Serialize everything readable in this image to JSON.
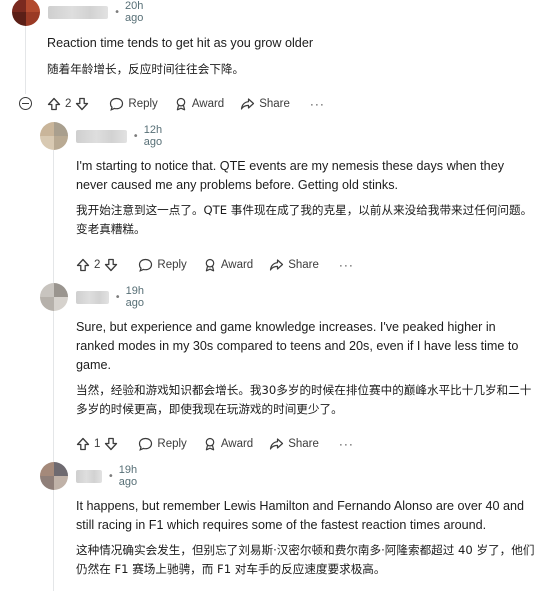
{
  "comments": [
    {
      "time": "20h ago",
      "text_en": "Reaction time tends to get hit as you grow older",
      "text_cn": "随着年龄增长，反应时间往往会下降。",
      "votes": "2",
      "avatar_colors": [
        "#7a2a1f",
        "#b24a2e",
        "#5b1f17",
        "#9a3a25"
      ]
    },
    {
      "time": "12h ago",
      "text_en": "I'm starting to notice that. QTE events are my nemesis these days when they never caused me any problems before. Getting old stinks.",
      "text_cn": "我开始注意到这一点了。QTE 事件现在成了我的克星，以前从来没给我带来过任何问题。变老真糟糕。",
      "votes": "2",
      "avatar_colors": [
        "#c9b59a",
        "#a99f8e",
        "#d8c9b2",
        "#b9aa93"
      ]
    },
    {
      "time": "19h ago",
      "text_en": "Sure, but experience and game knowledge increases. I've peaked higher in ranked modes in my 30s compared to teens and 20s, even if I have less time to game.",
      "text_cn": "当然，经验和游戏知识都会增长。我30多岁的时候在排位赛中的巅峰水平比十几岁和二十多岁的时候更高，即使我现在玩游戏的时间更少了。",
      "votes": "1",
      "avatar_colors": [
        "#c8c4bf",
        "#9a958f",
        "#b6b1ab",
        "#d6d2cd"
      ]
    },
    {
      "time": "19h ago",
      "text_en": "It happens, but remember Lewis Hamilton and Fernando Alonso are over 40 and still racing in F1 which requires some of the fastest reaction times around.",
      "text_cn": "这种情况确实会发生，但别忘了刘易斯·汉密尔顿和费尔南多·阿隆索都超过 40 岁了，他们仍然在 F1 赛场上驰骋，而 F1 对车手的反应速度要求极高。",
      "avatar_colors": [
        "#a4897a",
        "#6e6a70",
        "#8f7f79",
        "#c0b2a8"
      ]
    }
  ],
  "labels": {
    "reply": "Reply",
    "award": "Award",
    "share": "Share",
    "more": "···"
  },
  "icons": [
    "upvote-icon",
    "downvote-icon",
    "reply-icon",
    "award-icon",
    "share-icon",
    "collapse-icon",
    "more-icon"
  ]
}
